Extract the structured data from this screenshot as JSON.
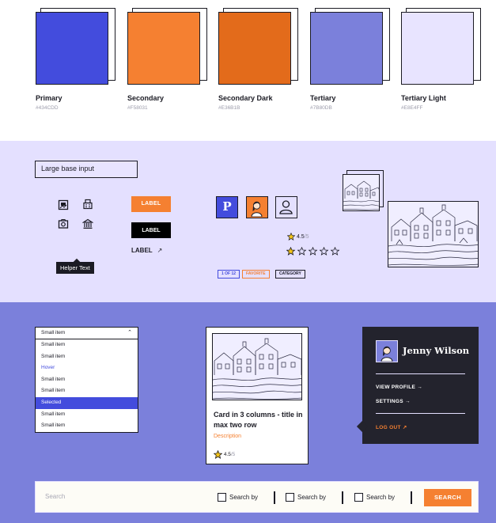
{
  "swatches": [
    {
      "name": "Primary",
      "hex": "#434CDD",
      "color": "#434cdd"
    },
    {
      "name": "Secondary",
      "hex": "#F58031",
      "color": "#f58031"
    },
    {
      "name": "Secondary Dark",
      "hex": "#E36B1B",
      "color": "#e36b1b"
    },
    {
      "name": "Tertiary",
      "hex": "#7B80DB",
      "color": "#7b80db"
    },
    {
      "name": "Tertiary Light",
      "hex": "#E8E4FF",
      "color": "#e8e4ff"
    }
  ],
  "inputs": {
    "large_base_input": "Large base input"
  },
  "tooltip": {
    "text": "Helper Text"
  },
  "buttons": {
    "primary_label": "LABEL",
    "secondary_label": "LABEL",
    "link_label": "LABEL",
    "link_arrow": "↗"
  },
  "avatars": {
    "letter": "P"
  },
  "ratings": {
    "small_value": "4.5",
    "small_total": "/5",
    "stars_filled": 1,
    "stars_total": 5
  },
  "tags": [
    "1 OF 12",
    "FAVORITE",
    "CATEGORY"
  ],
  "dropdown": {
    "selected_value": "Small item",
    "chevron": "⌃",
    "items": [
      {
        "label": "Small item",
        "state": "default"
      },
      {
        "label": "Small item",
        "state": "default"
      },
      {
        "label": "Hover",
        "state": "hover"
      },
      {
        "label": "Small item",
        "state": "default"
      },
      {
        "label": "Small item",
        "state": "default"
      },
      {
        "label": "Selected",
        "state": "selected"
      },
      {
        "label": "Small item",
        "state": "default"
      },
      {
        "label": "Small item",
        "state": "default"
      }
    ]
  },
  "card": {
    "title": "Card in 3 columns - title in max two row",
    "description": "Description",
    "rating": "4.5",
    "rating_total": "/5"
  },
  "profile_menu": {
    "user_name": "Jenny Wilson",
    "view_profile": "VIEW PROFILE",
    "settings": "SETTINGS",
    "log_out": "LOG OUT",
    "arrow_right": "→",
    "arrow_out": "↗"
  },
  "search": {
    "placeholder": "Search",
    "filters": [
      "Search by",
      "Search by",
      "Search by"
    ],
    "button_label": "SEARCH"
  },
  "colors": {
    "primary": "#434cdd",
    "secondary": "#f58031",
    "tertiary": "#7b80db",
    "tertiary_light": "#e4e0ff",
    "dark": "#23232d"
  }
}
